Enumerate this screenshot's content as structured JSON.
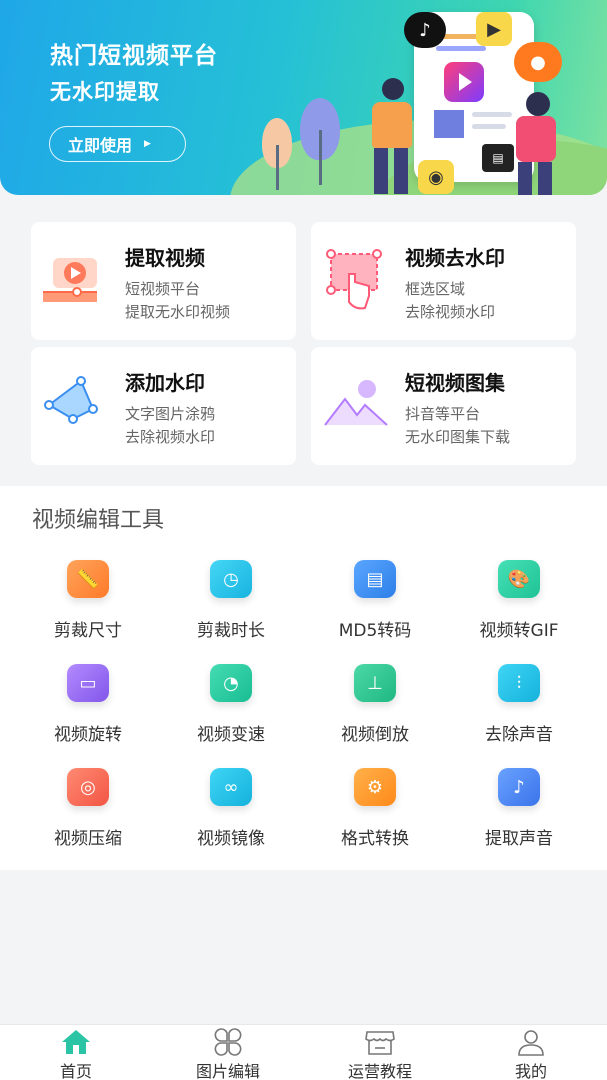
{
  "banner": {
    "title": "热门短视频平台",
    "subtitle": "无水印提取",
    "button": "立即使用"
  },
  "features": [
    {
      "title": "提取视频",
      "line1": "短视频平台",
      "line2": "提取无水印视频",
      "icon": "video-extract-icon"
    },
    {
      "title": "视频去水印",
      "line1": "框选区域",
      "line2": "去除视频水印",
      "icon": "select-area-hand-icon"
    },
    {
      "title": "添加水印",
      "line1": "文字图片涂鸦",
      "line2": "去除视频水印",
      "icon": "doodle-polygon-icon"
    },
    {
      "title": "短视频图集",
      "line1": "抖音等平台",
      "line2": "无水印图集下载",
      "icon": "image-gallery-icon"
    }
  ],
  "tools": {
    "title": "视频编辑工具",
    "items": [
      {
        "label": "剪裁尺寸",
        "icon": "ruler-icon",
        "color": "#ff8a3d"
      },
      {
        "label": "剪裁时长",
        "icon": "clock-icon",
        "color": "#22c4e8"
      },
      {
        "label": "MD5转码",
        "icon": "scroll-icon",
        "color": "#3d8ff0"
      },
      {
        "label": "视频转GIF",
        "icon": "palette-icon",
        "color": "#27cfa3"
      },
      {
        "label": "视频旋转",
        "icon": "screen-icon",
        "color": "#9b6cf2"
      },
      {
        "label": "视频变速",
        "icon": "speedometer-icon",
        "color": "#26c9a0"
      },
      {
        "label": "视频倒放",
        "icon": "stamp-icon",
        "color": "#2bc58f"
      },
      {
        "label": "去除声音",
        "icon": "soundwave-icon",
        "color": "#1fc0e6"
      },
      {
        "label": "视频压缩",
        "icon": "compress-icon",
        "color": "#ff6a58"
      },
      {
        "label": "视频镜像",
        "icon": "mirror-circles-icon",
        "color": "#1fbde6"
      },
      {
        "label": "格式转换",
        "icon": "gear-icon",
        "color": "#ff9a2a"
      },
      {
        "label": "提取声音",
        "icon": "music-note-icon",
        "color": "#4a86f2"
      }
    ]
  },
  "nav": [
    {
      "label": "首页",
      "icon": "home-icon",
      "active": true
    },
    {
      "label": "图片编辑",
      "icon": "four-petal-icon",
      "active": false
    },
    {
      "label": "运营教程",
      "icon": "store-icon",
      "active": false
    },
    {
      "label": "我的",
      "icon": "user-icon",
      "active": false
    }
  ],
  "colors": {
    "accent": "#2bc4a4",
    "banner_start": "#1fa7e8",
    "banner_end": "#7fe2a0"
  }
}
